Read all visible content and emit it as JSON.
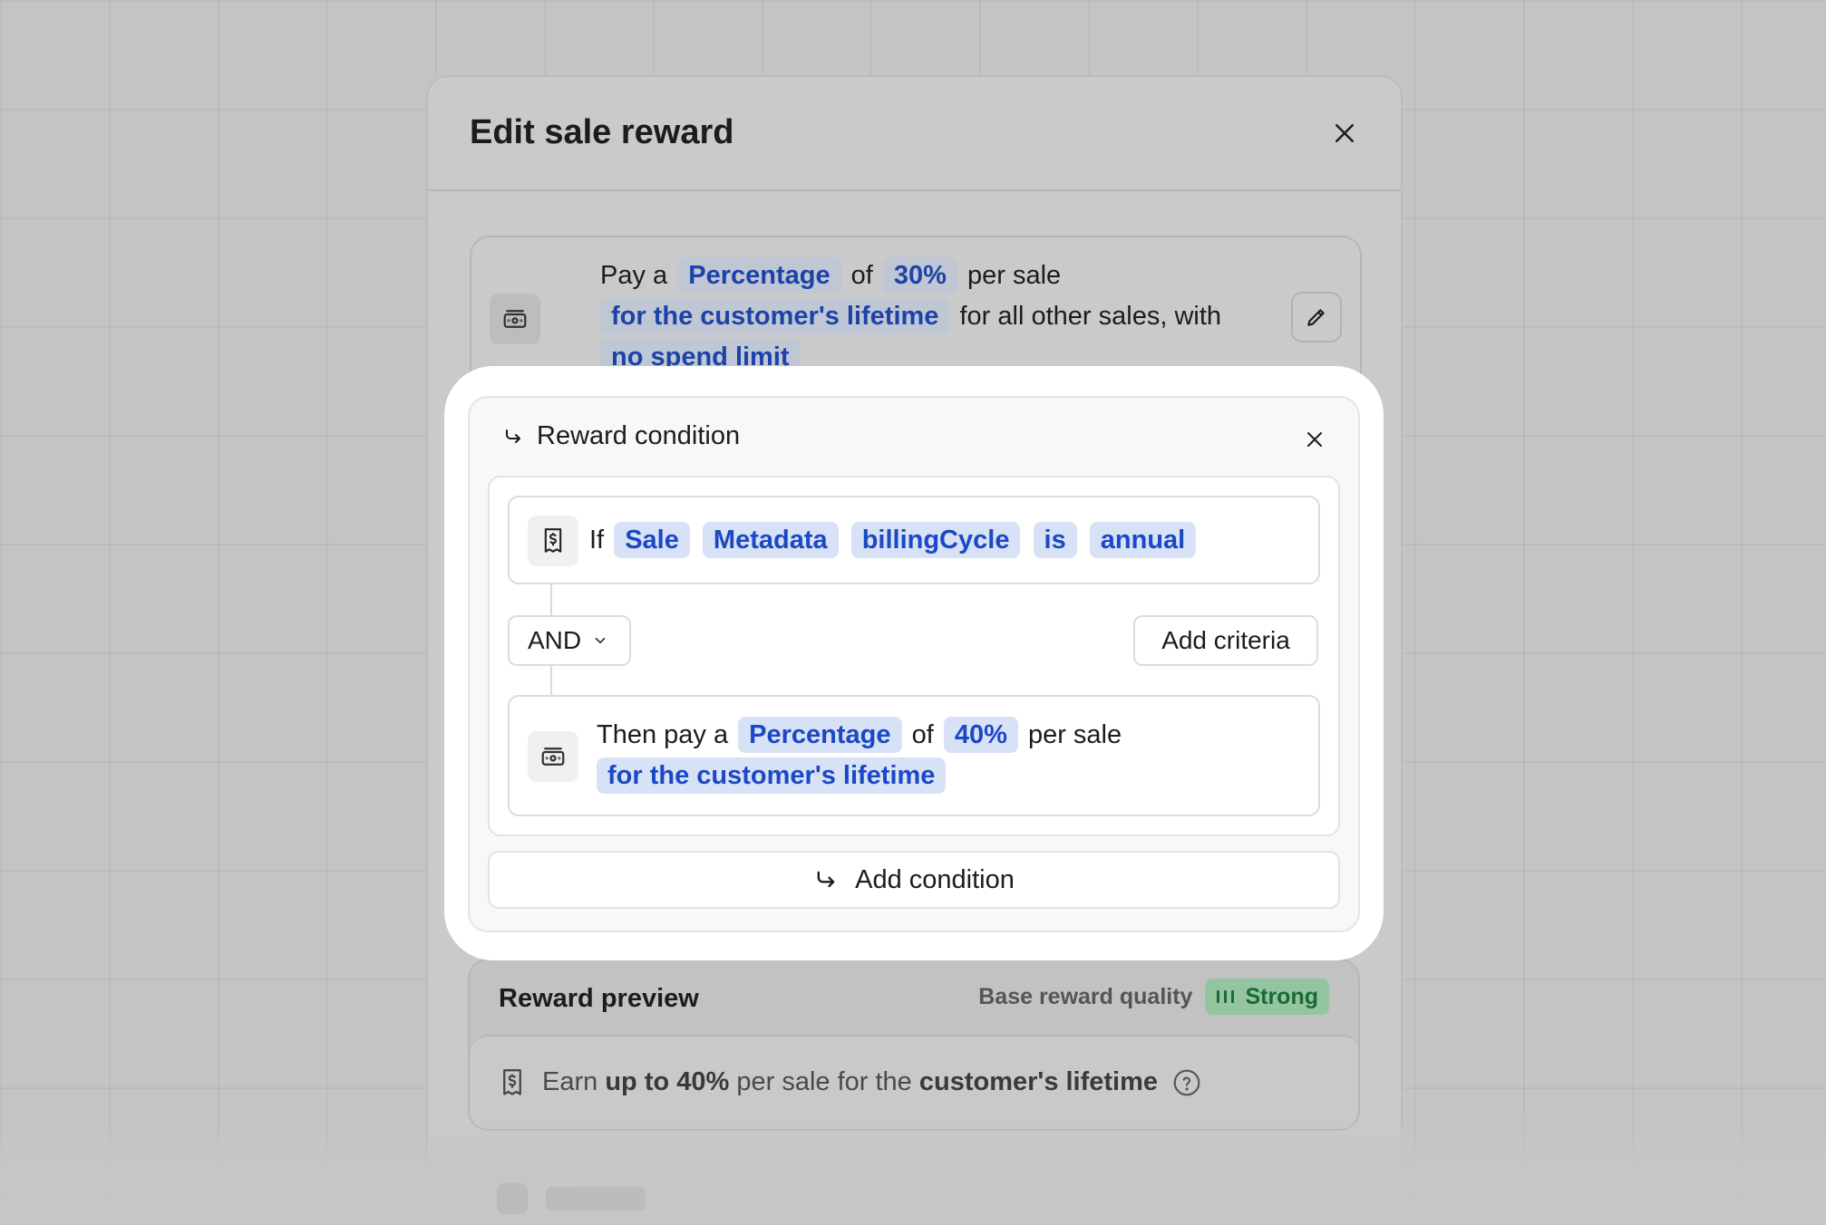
{
  "modal": {
    "title": "Edit sale reward"
  },
  "summary": {
    "w1": "Pay a",
    "chip_type": "Percentage",
    "w2": "of",
    "chip_amount": "30%",
    "w3": "per sale",
    "chip_duration": "for the customer's lifetime",
    "w4": "for all other sales, with",
    "chip_limit": "no spend limit"
  },
  "condition": {
    "title": "Reward condition",
    "if_label": "If",
    "if_chips": [
      "Sale",
      "Metadata",
      "billingCycle",
      "is",
      "annual"
    ],
    "operator": "AND",
    "add_criteria": "Add criteria",
    "then_w1": "Then pay a",
    "then_chip_type": "Percentage",
    "then_w2": "of",
    "then_chip_amount": "40%",
    "then_w3": "per sale",
    "then_chip_duration": "for the customer's lifetime",
    "add_condition": "Add condition"
  },
  "preview": {
    "title": "Reward preview",
    "quality_label": "Base reward quality",
    "quality_value": "Strong",
    "text_earn": "Earn",
    "text_amount": "up to 40%",
    "text_mid": "per sale for the",
    "text_duration": "customer's lifetime"
  },
  "icons": {
    "close": "close-icon",
    "money": "money-icon",
    "receipt": "receipt-dollar-icon",
    "edit": "pencil-icon",
    "arrow": "corner-down-right-icon",
    "chevron": "chevron-down-icon",
    "bars": "signal-bars-icon",
    "help": "help-circle-icon"
  },
  "colors": {
    "chip_text": "#1b48c4",
    "chip_bg": "#d8e2f6",
    "strong_text": "#1b6a35",
    "strong_bg": "#93c6a0"
  }
}
